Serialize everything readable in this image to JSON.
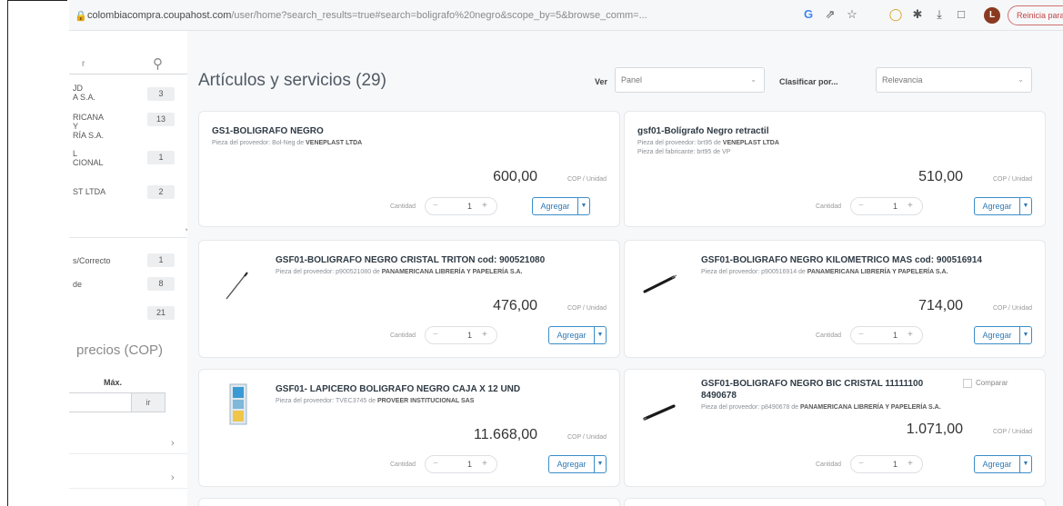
{
  "browser": {
    "url_host": "colombiacompra.coupahost.com",
    "url_path": "/user/home?search_results=true#search=boligrafo%20negro&scope_by=5&browse_comm=...",
    "update_label": "Reinicia para actualizar",
    "avatar_letter": "L",
    "icons": [
      "lock-icon",
      "google-icon",
      "share-icon",
      "star-icon",
      "extension-icon",
      "puzzle-icon",
      "download-icon",
      "sidebar-icon"
    ]
  },
  "sidebar": {
    "search_value": "r",
    "suppliers": [
      {
        "label": "JD\nA S.A.",
        "count": "3"
      },
      {
        "label": "RICANA\nY\nRÍA S.A.",
        "count": "13"
      },
      {
        "label": "L\nCIONAL",
        "count": "1"
      },
      {
        "label": "ST LTDA",
        "count": "2"
      }
    ],
    "filters": [
      {
        "label": "s/Correcto",
        "count": "1"
      },
      {
        "label": "de",
        "count": "8"
      },
      {
        "label": "",
        "count": "21"
      }
    ],
    "prices_title": "precios (COP)",
    "max_label": "Máx.",
    "go_label": "ir"
  },
  "main": {
    "title": "Artículos y servicios (29)",
    "view_label": "Ver",
    "view_value": "Panel",
    "sort_label": "Clasificar por...",
    "sort_value": "Relevancia",
    "qty_label": "Cantidad",
    "add_label": "Agregar",
    "compare_label": "Comparar",
    "items": [
      {
        "name": "GS1-BOLIGRAFO NEGRO",
        "name2": "",
        "supplier_line": "Pieza del proveedor: Bol-Neg de",
        "supplier": "VENEPLAST LTDA",
        "mfr_line": "",
        "price": "600,00",
        "unit": "COP / Unidad",
        "qty": "1",
        "image": "none"
      },
      {
        "name": "gsf01-Bolígrafo Negro retractil",
        "name2": "",
        "supplier_line": "Pieza del proveedor: brt95 de",
        "supplier": "VENEPLAST LTDA",
        "mfr_line": "Pieza del fabricante: brt95 de VP",
        "price": "510,00",
        "unit": "COP / Unidad",
        "qty": "1",
        "image": "none"
      },
      {
        "name": "GSF01-BOLIGRAFO NEGRO CRISTAL TRITON cod: 900521080",
        "name2": "",
        "supplier_line": "Pieza del proveedor: p900521080 de",
        "supplier": "PANAMERICANA LIBRERÍA Y PAPELERÍA S.A.",
        "mfr_line": "",
        "price": "476,00",
        "unit": "COP / Unidad",
        "qty": "1",
        "image": "pen-thin-icon"
      },
      {
        "name": "GSF01-BOLIGRAFO NEGRO KILOMETRICO MAS cod: 900516914",
        "name2": "",
        "supplier_line": "Pieza del proveedor: p900516914 de",
        "supplier": "PANAMERICANA LIBRERÍA Y PAPELERÍA S.A.",
        "mfr_line": "",
        "price": "714,00",
        "unit": "COP / Unidad",
        "qty": "1",
        "image": "pen-black-icon"
      },
      {
        "name": "GSF01- LAPICERO BOLIGRAFO NEGRO CAJA X 12 UND",
        "name2": "",
        "supplier_line": "Pieza del proveedor: TVEC3745 de",
        "supplier": "PROVEER INSTITUCIONAL SAS",
        "mfr_line": "",
        "price": "11.668,00",
        "unit": "COP / Unidad",
        "qty": "1",
        "image": "pen-box-icon"
      },
      {
        "name": "GSF01-BOLIGRAFO NEGRO BIC CRISTAL 11111100",
        "name2": "8490678",
        "supplier_line": "Pieza del proveedor: p8490678 de",
        "supplier": "PANAMERICANA LIBRERÍA Y PAPELERÍA S.A.",
        "mfr_line": "",
        "price": "1.071,00",
        "unit": "COP / Unidad",
        "qty": "1",
        "image": "pen-bic-icon"
      }
    ]
  }
}
